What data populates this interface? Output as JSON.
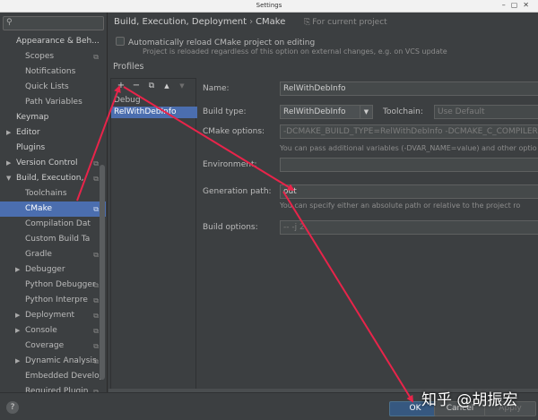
{
  "window": {
    "title": "Settings"
  },
  "search": {
    "value": "",
    "placeholder": ""
  },
  "sidebar": {
    "items": [
      {
        "label": "Appearance & Beh...",
        "level": 1,
        "arrow": ""
      },
      {
        "label": "Scopes",
        "level": 2,
        "copy": true
      },
      {
        "label": "Notifications",
        "level": 2
      },
      {
        "label": "Quick Lists",
        "level": 2
      },
      {
        "label": "Path Variables",
        "level": 2
      },
      {
        "label": "Keymap",
        "level": 1
      },
      {
        "label": "Editor",
        "level": 1,
        "arrow": "right"
      },
      {
        "label": "Plugins",
        "level": 1
      },
      {
        "label": "Version Control",
        "level": 1,
        "arrow": "right",
        "copy": true
      },
      {
        "label": "Build, Execution,",
        "level": 1,
        "arrow": "down",
        "copy": true
      },
      {
        "label": "Toolchains",
        "level": 2
      },
      {
        "label": "CMake",
        "level": 2,
        "copy": true,
        "selected": true
      },
      {
        "label": "Compilation Dat",
        "level": 2
      },
      {
        "label": "Custom Build Ta",
        "level": 2
      },
      {
        "label": "Gradle",
        "level": 2,
        "copy": true
      },
      {
        "label": "Debugger",
        "level": 2,
        "arrow": "right"
      },
      {
        "label": "Python Debugger",
        "level": 2,
        "copy": true
      },
      {
        "label": "Python Interpre",
        "level": 2,
        "copy": true
      },
      {
        "label": "Deployment",
        "level": 2,
        "arrow": "right",
        "copy": true
      },
      {
        "label": "Console",
        "level": 2,
        "arrow": "right",
        "copy": true
      },
      {
        "label": "Coverage",
        "level": 2,
        "copy": true
      },
      {
        "label": "Dynamic Analysis",
        "level": 2,
        "arrow": "right",
        "copy": true
      },
      {
        "label": "Embedded Develop",
        "level": 2
      },
      {
        "label": "Required Plugin",
        "level": 2,
        "copy": true
      }
    ]
  },
  "header": {
    "breadcrumb": [
      "Build, Execution, Deployment",
      "CMake"
    ],
    "scope_note": "For current project"
  },
  "auto_reload": {
    "label": "Automatically reload CMake project on editing",
    "checked": false,
    "hint": "Project is reloaded regardless of this option on external changes, e.g. on VCS update"
  },
  "profiles": {
    "heading": "Profiles",
    "toolbar": {
      "add": "+",
      "remove": "−",
      "copy": "⧉",
      "up": "▲",
      "down": "▼"
    },
    "items": [
      {
        "label": "Debug",
        "selected": false
      },
      {
        "label": "RelWithDebInfo",
        "selected": true
      }
    ]
  },
  "form": {
    "name": {
      "label": "Name:",
      "value": "RelWithDebInfo"
    },
    "build_type": {
      "label": "Build type:",
      "value": "RelWithDebInfo"
    },
    "toolchain": {
      "label": "Toolchain:",
      "value": "Use Default"
    },
    "cmake_options": {
      "label": "CMake options:",
      "value": "-DCMAKE_BUILD_TYPE=RelWithDebInfo -DCMAKE_C_COMPILER=/bin/",
      "note": "You can pass additional variables (-DVAR_NAME=value) and other optio"
    },
    "environment": {
      "label": "Environment:",
      "value": ""
    },
    "generation_path": {
      "label": "Generation path:",
      "value": "out",
      "note": "You can specify either an absolute path or relative to the project ro"
    },
    "build_options": {
      "label": "Build options:",
      "value": "-- -j 2"
    }
  },
  "footer": {
    "help": "?",
    "ok": "OK",
    "cancel": "Cancel",
    "apply": "Apply"
  },
  "watermark": "知乎 @胡振宏",
  "colors": {
    "background": "#3c3f41",
    "selection": "#4b6eaf",
    "annotation_arrow": "#e8244a",
    "primary_button": "#365880"
  }
}
